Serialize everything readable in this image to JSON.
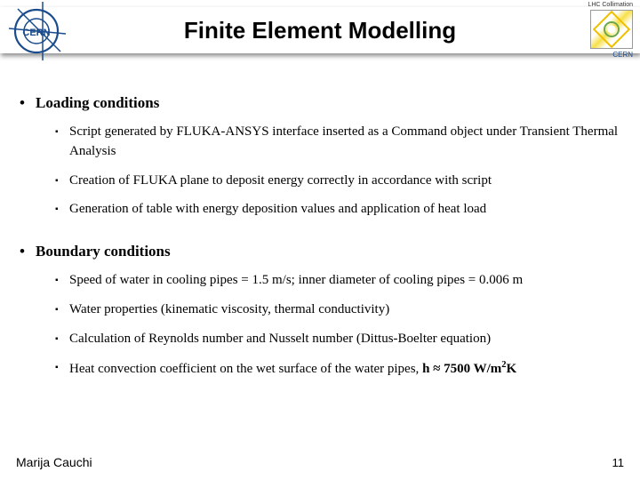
{
  "header": {
    "title": "Finite Element Modelling",
    "logo_left_text": "CERN",
    "logo_right_label": "LHC Collimation",
    "logo_right_sub": "CERN"
  },
  "sections": [
    {
      "heading": "Loading conditions",
      "items": [
        "Script generated by FLUKA-ANSYS interface inserted as a Command object under Transient Thermal Analysis",
        "Creation of FLUKA plane to deposit energy correctly in accordance with script",
        "Generation of table with energy deposition values and application of heat load"
      ]
    },
    {
      "heading": "Boundary conditions",
      "items": [
        "Speed of water in cooling pipes = 1.5 m/s; inner diameter of cooling pipes = 0.006 m",
        "Water properties (kinematic viscosity, thermal conductivity)",
        "Calculation of Reynolds number and Nusselt number (Dittus-Boelter equation)",
        "Heat convection coefficient on the wet surface of the water pipes, h ≈ 7500 W/m²K"
      ]
    }
  ],
  "footer": {
    "author": "Marija Cauchi",
    "page": "11"
  }
}
